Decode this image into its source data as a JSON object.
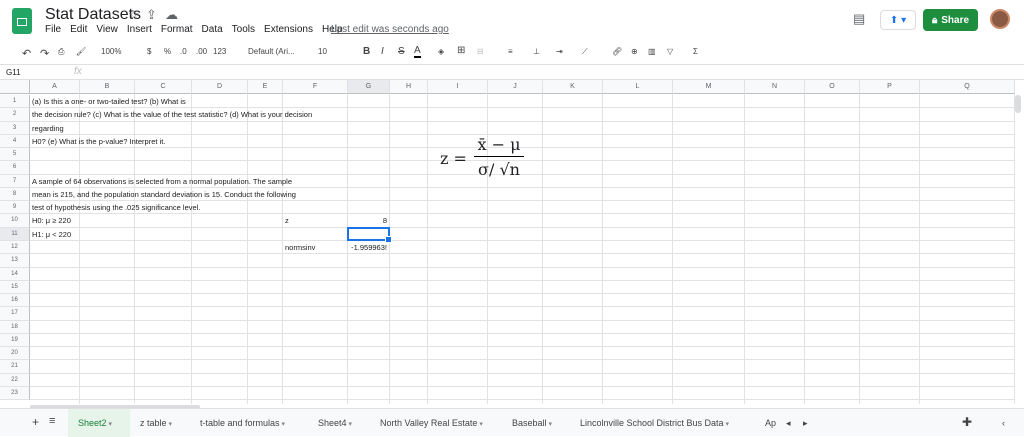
{
  "app": {
    "title": "Stat Datasets",
    "last_edit": "Last edit was seconds ago",
    "share_label": "Share"
  },
  "menu": [
    "File",
    "Edit",
    "View",
    "Insert",
    "Format",
    "Data",
    "Tools",
    "Extensions",
    "Help"
  ],
  "toolbar": {
    "zoom": "100%",
    "currency": "$",
    "percent": "%",
    "dec_less": ".0",
    "dec_more": ".00",
    "format": "123",
    "font": "Default (Ari...",
    "size": "10",
    "bold": "B",
    "italic": "I",
    "strike": "S",
    "textcolor": "A"
  },
  "formula_bar": {
    "name_box": "G11",
    "fx": "fx",
    "value": ""
  },
  "columns": [
    "A",
    "B",
    "C",
    "D",
    "E",
    "F",
    "G",
    "H",
    "I",
    "J",
    "K",
    "L",
    "M",
    "N",
    "O",
    "P",
    "Q"
  ],
  "selected_column": "G",
  "rows": [
    "1",
    "2",
    "3",
    "4",
    "5",
    "6",
    "7",
    "8",
    "9",
    "10",
    "11",
    "12",
    "13",
    "14",
    "15",
    "16",
    "17",
    "18",
    "19",
    "20",
    "21",
    "22",
    "23"
  ],
  "cells": {
    "A1": "(a) Is this a one- or two-tailed test? (b) What is",
    "A2": "the decision rule? (c) What is the value of the test statistic? (d) What is your decision",
    "A3": "regarding",
    "A4": "H0? (e) What is the p-value? Interpret it.",
    "A7": "A sample of 64 observations is selected from a normal population. The sample",
    "A8": "mean is 215, and the population standard deviation is 15. Conduct the following",
    "A9": "test of hypothesis using the .025 significance level.",
    "A10": "H0: μ ≥ 220",
    "A11": "H1: μ < 220",
    "F10": "z",
    "G10": "8",
    "F12": "normsinv",
    "G12": "-1.959963!"
  },
  "formula_image": {
    "lhs": "z =",
    "numerator": "x̄ − μ",
    "denominator": "σ/ √n"
  },
  "sheet_tabs": [
    "Sheet2",
    "z table",
    "t-table and formulas",
    "Sheet4",
    "North Valley Real Estate",
    "Baseball",
    "Lincolnville School District Bus Data",
    "Ap"
  ],
  "active_tab": "Sheet2"
}
